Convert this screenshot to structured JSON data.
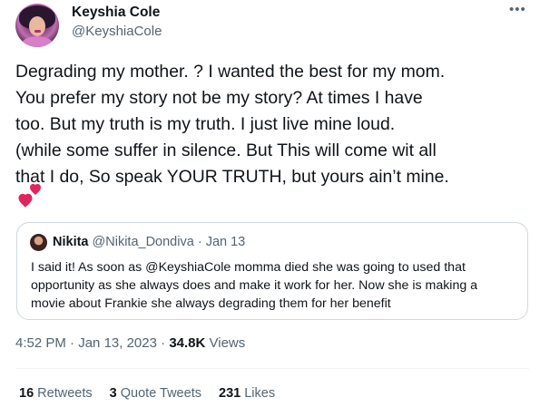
{
  "author": {
    "name": "Keyshia Cole",
    "handle": "@KeyshiaCole"
  },
  "more_icon": "more-horizontal-icon",
  "tweet": {
    "text": "Degrading my mother. ? I wanted the best for my mom.\nYou prefer my story not be my story? At times I have\ntoo. But my truth is my truth. I just live mine loud.\n(while some suffer in silence. But This will come wit all\nthat I do, So speak YOUR TRUTH, but yours ain’t mine.",
    "emoji": "two-hearts-icon"
  },
  "quoted": {
    "name": "Nikita",
    "handle": "@Nikita_Dondiva",
    "separator": "·",
    "date": "Jan 13",
    "text": "I said it! As soon as @KeyshiaCole momma died she was going to used that\nopportunity as she always does and make it work for her. Now she is making a\nmovie about Frankie she always degrading them for her benefit"
  },
  "meta": {
    "time": "4:52 PM",
    "separator": "·",
    "date": "Jan 13, 2023",
    "views_count": "34.8K",
    "views_label": "Views"
  },
  "stats": [
    {
      "count": "16",
      "label": "Retweets"
    },
    {
      "count": "3",
      "label": "Quote Tweets"
    },
    {
      "count": "231",
      "label": "Likes"
    }
  ],
  "colors": {
    "text": "#0f1419",
    "secondary": "#536471",
    "border": "#cfd9de",
    "heart": "#e0245e"
  }
}
